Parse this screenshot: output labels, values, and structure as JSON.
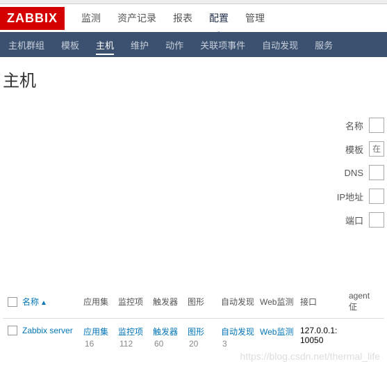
{
  "logo": "ZABBIX",
  "mainNav": {
    "items": [
      {
        "label": "监测",
        "active": false
      },
      {
        "label": "资产记录",
        "active": false
      },
      {
        "label": "报表",
        "active": false
      },
      {
        "label": "配置",
        "active": true
      },
      {
        "label": "管理",
        "active": false
      }
    ]
  },
  "subNav": {
    "items": [
      {
        "label": "主机群组",
        "active": false
      },
      {
        "label": "模板",
        "active": false
      },
      {
        "label": "主机",
        "active": true
      },
      {
        "label": "维护",
        "active": false
      },
      {
        "label": "动作",
        "active": false
      },
      {
        "label": "关联项事件",
        "active": false
      },
      {
        "label": "自动发现",
        "active": false
      },
      {
        "label": "服务",
        "active": false
      }
    ]
  },
  "pageTitle": "主机",
  "filters": {
    "name": {
      "label": "名称",
      "value": ""
    },
    "template": {
      "label": "模板",
      "placeholder": "在此"
    },
    "dns": {
      "label": "DNS",
      "value": ""
    },
    "ip": {
      "label": "IP地址",
      "value": ""
    },
    "port": {
      "label": "端口",
      "value": ""
    }
  },
  "table": {
    "headers": {
      "name": "名称",
      "app": "应用集",
      "monitor": "监控项",
      "trigger": "触发器",
      "graph": "图形",
      "auto": "自动发现",
      "web": "Web监测",
      "interface": "接口",
      "agent": "agent佂"
    },
    "rows": [
      {
        "name": "Zabbix server",
        "app": {
          "label": "应用集",
          "count": "16"
        },
        "monitor": {
          "label": "监控项",
          "count": "112"
        },
        "trigger": {
          "label": "触发器",
          "count": "60"
        },
        "graph": {
          "label": "图形",
          "count": "20"
        },
        "auto": {
          "label": "自动发现",
          "count": "3"
        },
        "web": {
          "label": "Web监测"
        },
        "interface": "127.0.0.1: 10050"
      }
    ]
  },
  "watermark": "https://blog.csdn.net/thermal_life"
}
